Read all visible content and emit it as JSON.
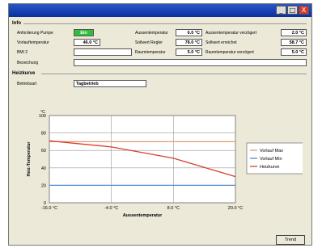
{
  "window": {
    "buttons": [
      "_",
      "□",
      "X"
    ]
  },
  "info": {
    "title": "Info",
    "pump_label": "Anforderung Pumpe",
    "pump_value": "Ein",
    "vorlauf_label": "Vorlauftemperatur",
    "vorlauf_value": "46.0 °C",
    "aussen_label": "Aussentemperatur",
    "aussen_value": "6.0 °C",
    "aussen_verz_label": "Aussentemperatur verzögert",
    "aussen_verz_value": "2.0 °C",
    "bmi_label": "BMI 2",
    "bmi_value": "",
    "sollwert_regler_label": "Sollwert Regler",
    "sollwert_regler_value": "78.0 °C",
    "sollwert_erreicht_label": "Sollwert erreichet",
    "sollwert_erreicht_value": "58.7 °C",
    "raum_label": "Raumtemperatur",
    "raum_value": "5.0 °C",
    "raum_verz_label": "Raumtemperatur verzögert",
    "raum_verz_value": "5.0 °C",
    "bez_label": "Bezeichung",
    "bez_value": ""
  },
  "heizkurve": {
    "title": "Heizkurve",
    "betriebsart_label": "Betriebsart",
    "betriebsart_value": "Tagbetrieb"
  },
  "chart_data": {
    "type": "line",
    "ylabel": "Heiz-Temperatur",
    "xlabel": "Aussentemperatur",
    "y_unit": "°C",
    "ylim": [
      0,
      100
    ],
    "xlim": [
      -16,
      20
    ],
    "y_ticks": [
      "0",
      "20",
      "40",
      "60",
      "80",
      "100"
    ],
    "x_ticks": [
      "-16.0 °C",
      "-4.0 °C",
      "8.0 °C",
      "20.0 °C"
    ],
    "grid": true,
    "legend_position": "right",
    "series": [
      {
        "name": "Vorlauf Max",
        "color": "#e89a6a",
        "x": [
          -16,
          20
        ],
        "y": [
          70,
          70
        ]
      },
      {
        "name": "Vorlauf Min",
        "color": "#4a8fd6",
        "x": [
          -16,
          20
        ],
        "y": [
          20,
          20
        ]
      },
      {
        "name": "Heizkurve",
        "color": "#d6402a",
        "x": [
          -16,
          -4,
          8,
          20
        ],
        "y": [
          71,
          64,
          51,
          30
        ]
      }
    ]
  },
  "trend_button": "Trend"
}
